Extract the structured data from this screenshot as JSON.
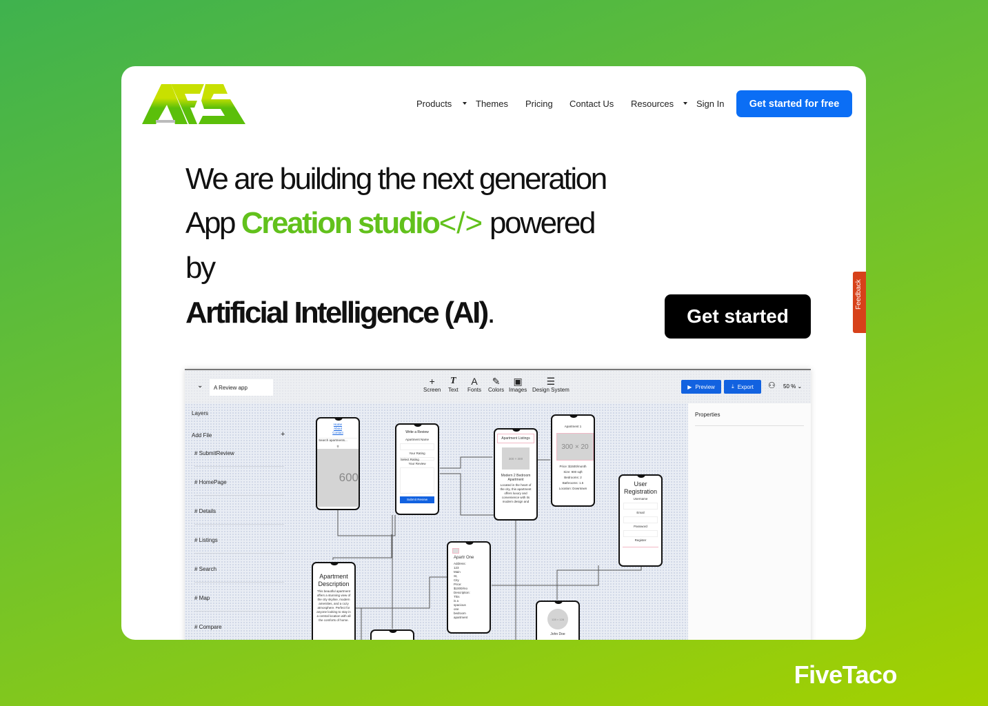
{
  "logo": {
    "text": "AFS",
    "colors": [
      "#c8e000",
      "#5bbf0a"
    ]
  },
  "nav": {
    "items": [
      {
        "label": "Products",
        "dropdown": true
      },
      {
        "label": "Themes"
      },
      {
        "label": "Pricing"
      },
      {
        "label": "Contact Us"
      },
      {
        "label": "Resources",
        "dropdown": true
      },
      {
        "label": "Sign In"
      }
    ],
    "cta": "Get started for free"
  },
  "hero": {
    "line1": "We are building the next generation",
    "line2_a": "App ",
    "line2_green": "Creation studio",
    "line2_code": "</>",
    "line2_b": " powered",
    "line3": "by",
    "line4": "Artificial Intelligence (AI)",
    "line4_dot": ".",
    "button": "Get started",
    "accent": "#62c11c"
  },
  "feedback": "Feedback",
  "editor": {
    "app_name": "A Review app",
    "tools": [
      {
        "icon": "plus-icon",
        "label": "Screen"
      },
      {
        "icon": "text-icon",
        "label": "Text"
      },
      {
        "icon": "font-icon",
        "label": "Fonts"
      },
      {
        "icon": "colors-icon",
        "label": "Colors"
      },
      {
        "icon": "image-icon",
        "label": "Images"
      },
      {
        "icon": "list-icon",
        "label": "Design System"
      }
    ],
    "preview": "Preview",
    "export": "Export",
    "zoom": "50 %",
    "layers_title": "Layers",
    "add_file": "Add File",
    "layers": [
      "SubmitReview",
      "HomePage",
      "Details",
      "Listings",
      "Search",
      "Map",
      "Compare"
    ],
    "properties": "Properties",
    "screens": {
      "home": {
        "links": [
          "Home",
          "About",
          "Contact"
        ],
        "search": "Search apartments...",
        "img": "600"
      },
      "review": {
        "title": "Write a Review",
        "f1": "Apartment Name",
        "f2": "Your Rating",
        "select": "Select Rating",
        "f3": "Your Review",
        "submit": "Submit Review"
      },
      "listings": {
        "title": "Apartment Listings",
        "img": "300 × 300",
        "name": "Modern 2 Bedroom Apartment",
        "desc": "Located in the heart of the city, this apartment offers luxury and convenience with its modern design and"
      },
      "apt1": {
        "title": "Apartment 1",
        "img": "300 × 20",
        "lines": [
          "Price: $1500/month",
          "Size: 900 sqft",
          "Bedrooms: 2",
          "Bathrooms: 1.5",
          "Location: Downtown"
        ]
      },
      "reg": {
        "title": "User Registration",
        "fields": [
          "Username",
          "Email",
          "Password"
        ],
        "button": "Register"
      },
      "desc": {
        "title": "Apartment Description",
        "text": "This beautiful apartment offers a stunning view of the city skyline, modern amenities, and a cozy atmosphere. Perfect for anyone looking to stay in a central location with all the comforts of home."
      },
      "one": {
        "title": "Apartr One",
        "lines": [
          "Address:",
          "123",
          "Main",
          "St,",
          "City",
          "Price:",
          "$1000/mo",
          "Description:",
          "This",
          "is a",
          "spacious",
          "one",
          "bedroom",
          "apartment"
        ]
      },
      "profile": {
        "avatar": "128 × 128",
        "name": "John Doe"
      }
    }
  },
  "footer_brand": "FiveTaco"
}
